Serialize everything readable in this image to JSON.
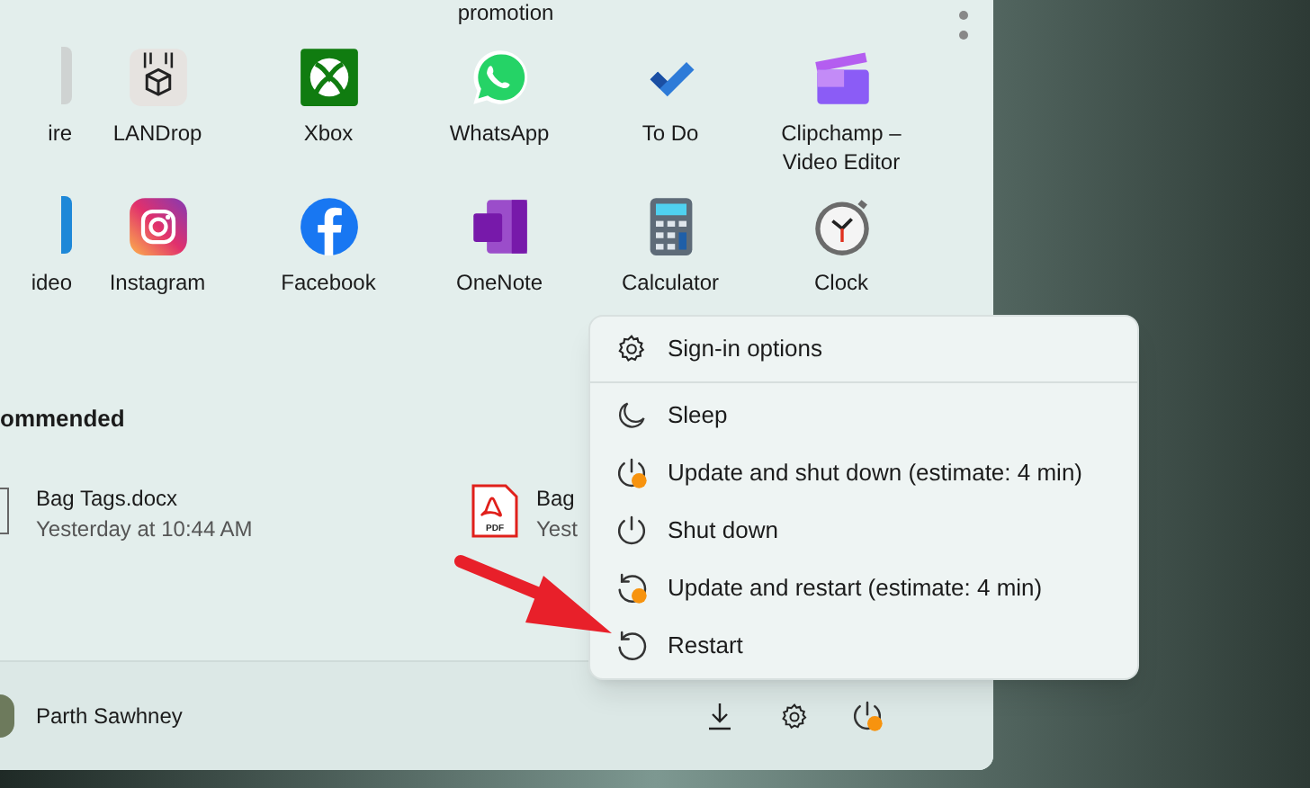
{
  "top_label": "promotion",
  "pinned_rows": [
    {
      "cut_label": "ire",
      "apps": [
        {
          "label": "LANDrop"
        },
        {
          "label": "Xbox"
        },
        {
          "label": "WhatsApp"
        },
        {
          "label": "To Do"
        },
        {
          "label": "Clipchamp –\nVideo Editor"
        }
      ]
    },
    {
      "cut_label": "ideo",
      "apps": [
        {
          "label": "Instagram"
        },
        {
          "label": "Facebook"
        },
        {
          "label": "OneNote"
        },
        {
          "label": "Calculator"
        },
        {
          "label": "Clock"
        }
      ]
    }
  ],
  "recommended": {
    "title": "ommended",
    "items": [
      {
        "kind": "doc",
        "name": "Bag Tags.docx",
        "time": "Yesterday at 10:44 AM"
      },
      {
        "kind": "pdf",
        "icon_text": "PDF",
        "name": "Bag",
        "time": "Yest"
      }
    ]
  },
  "user": {
    "name": "Parth Sawhney"
  },
  "footer": {
    "update_pending": true
  },
  "power_menu": {
    "items": [
      {
        "kind": "settings",
        "label": "Sign-in options"
      },
      {
        "kind": "sleep",
        "label": "Sleep"
      },
      {
        "kind": "update-shutdown",
        "label": "Update and shut down (estimate: 4 min)"
      },
      {
        "kind": "shutdown",
        "label": "Shut down"
      },
      {
        "kind": "update-restart",
        "label": "Update and restart (estimate: 4 min)"
      },
      {
        "kind": "restart",
        "label": "Restart"
      }
    ]
  }
}
